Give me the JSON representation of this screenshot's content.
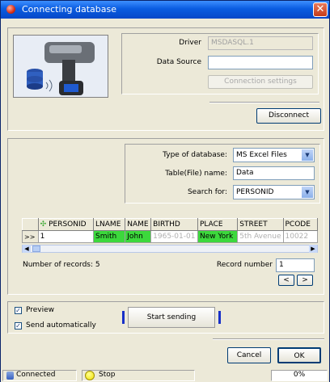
{
  "window": {
    "title": "Connecting database"
  },
  "connection": {
    "driver_label": "Driver",
    "driver_value": "MSDASQL.1",
    "datasource_label": "Data Source",
    "datasource_value": "",
    "settings_button": "Connection settings",
    "disconnect_button": "Disconnect"
  },
  "query": {
    "type_label": "Type of database:",
    "type_value": "MS Excel Files",
    "table_label": "Table(File) name:",
    "table_value": "Data",
    "search_label": "Search for:",
    "search_value": "PERSONID"
  },
  "grid": {
    "columns": [
      "PERSONID",
      "LNAME",
      "NAME",
      "BIRTHD",
      "PLACE",
      "STREET",
      "PCODE"
    ],
    "row_marker": ">>",
    "row": [
      "1",
      "Smith",
      "John",
      "1965-01-01",
      "New York",
      "5th Avenue",
      "10022"
    ]
  },
  "records": {
    "count_label": "Number of records: 5",
    "record_number_label": "Record number",
    "record_number_value": "1",
    "prev_button": "<",
    "next_button": ">"
  },
  "sending": {
    "preview_label": "Preview",
    "preview_checked": true,
    "auto_label": "Send automatically",
    "auto_checked": true,
    "start_button": "Start sending",
    "accent": "#1830c8"
  },
  "footer": {
    "cancel_button": "Cancel",
    "ok_button": "OK"
  },
  "status": {
    "connection": "Connected",
    "state": "Stop",
    "progress": "0%",
    "progress_value": 0
  }
}
